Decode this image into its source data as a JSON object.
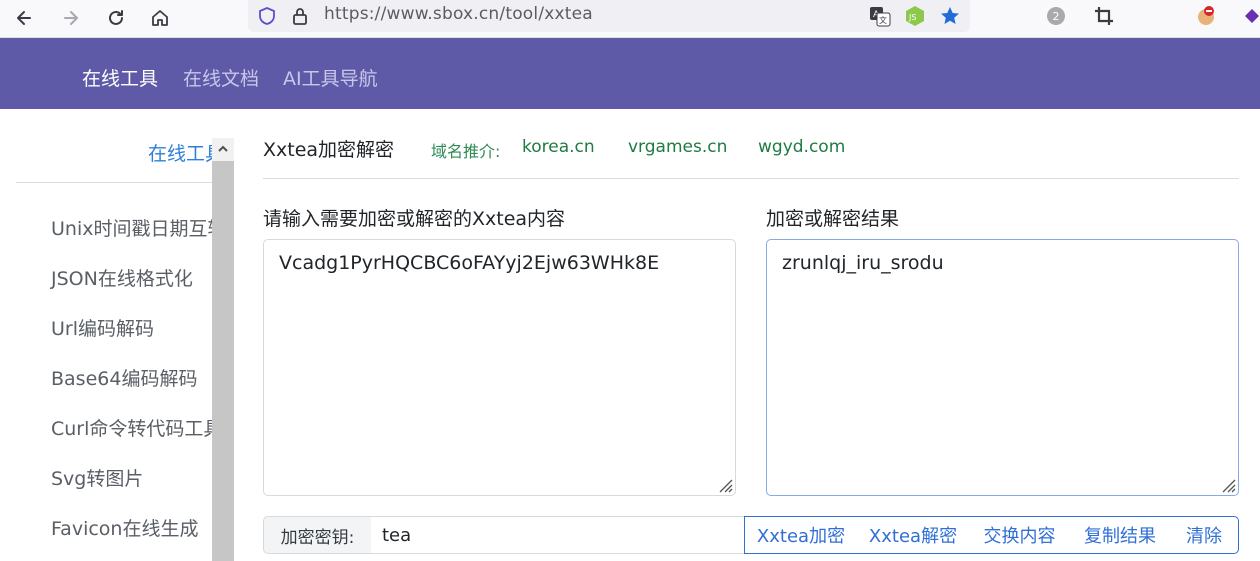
{
  "browser": {
    "url": "https://www.sbox.cn/tool/xxtea",
    "icons": [
      "back-icon",
      "forward-icon",
      "reload-icon",
      "home-icon",
      "shield-icon",
      "lock-icon",
      "translate-icon",
      "nodejs-icon",
      "bookmark-star-icon",
      "badge-2-icon",
      "crop-icon",
      "extension-icon"
    ],
    "badge_count": "2"
  },
  "header": {
    "nav": [
      {
        "label": "在线工具"
      },
      {
        "label": "在线文档"
      },
      {
        "label": "AI工具导航"
      }
    ],
    "bg_color": "#5f5aa8"
  },
  "sidebar": {
    "title": "在线工具",
    "items": [
      {
        "label": "Unix时间戳日期互转"
      },
      {
        "label": "JSON在线格式化"
      },
      {
        "label": "Url编码解码"
      },
      {
        "label": "Base64编码解码"
      },
      {
        "label": "Curl命令转代码工具"
      },
      {
        "label": "Svg转图片"
      },
      {
        "label": "Favicon在线生成"
      }
    ]
  },
  "main": {
    "title": "Xxtea加密解密",
    "domain_label": "域名推介:",
    "domains": [
      "korea.cn",
      "vrgames.cn",
      "wgyd.com"
    ],
    "input_label": "请输入需要加密或解密的Xxtea内容",
    "input_value": "Vcadg1PyrHQCBC6oFAYyj2Ejw63WHk8E",
    "output_label": "加密或解密结果",
    "output_value": "zrunlqj_iru_srodu",
    "key_label": "加密密钥:",
    "key_value": "tea",
    "buttons": {
      "encrypt": "Xxtea加密",
      "decrypt": "Xxtea解密",
      "swap": "交换内容",
      "copy": "复制结果",
      "clear": "清除"
    },
    "accent_color": "#2f6fd6",
    "link_color": "#1e7b41"
  }
}
